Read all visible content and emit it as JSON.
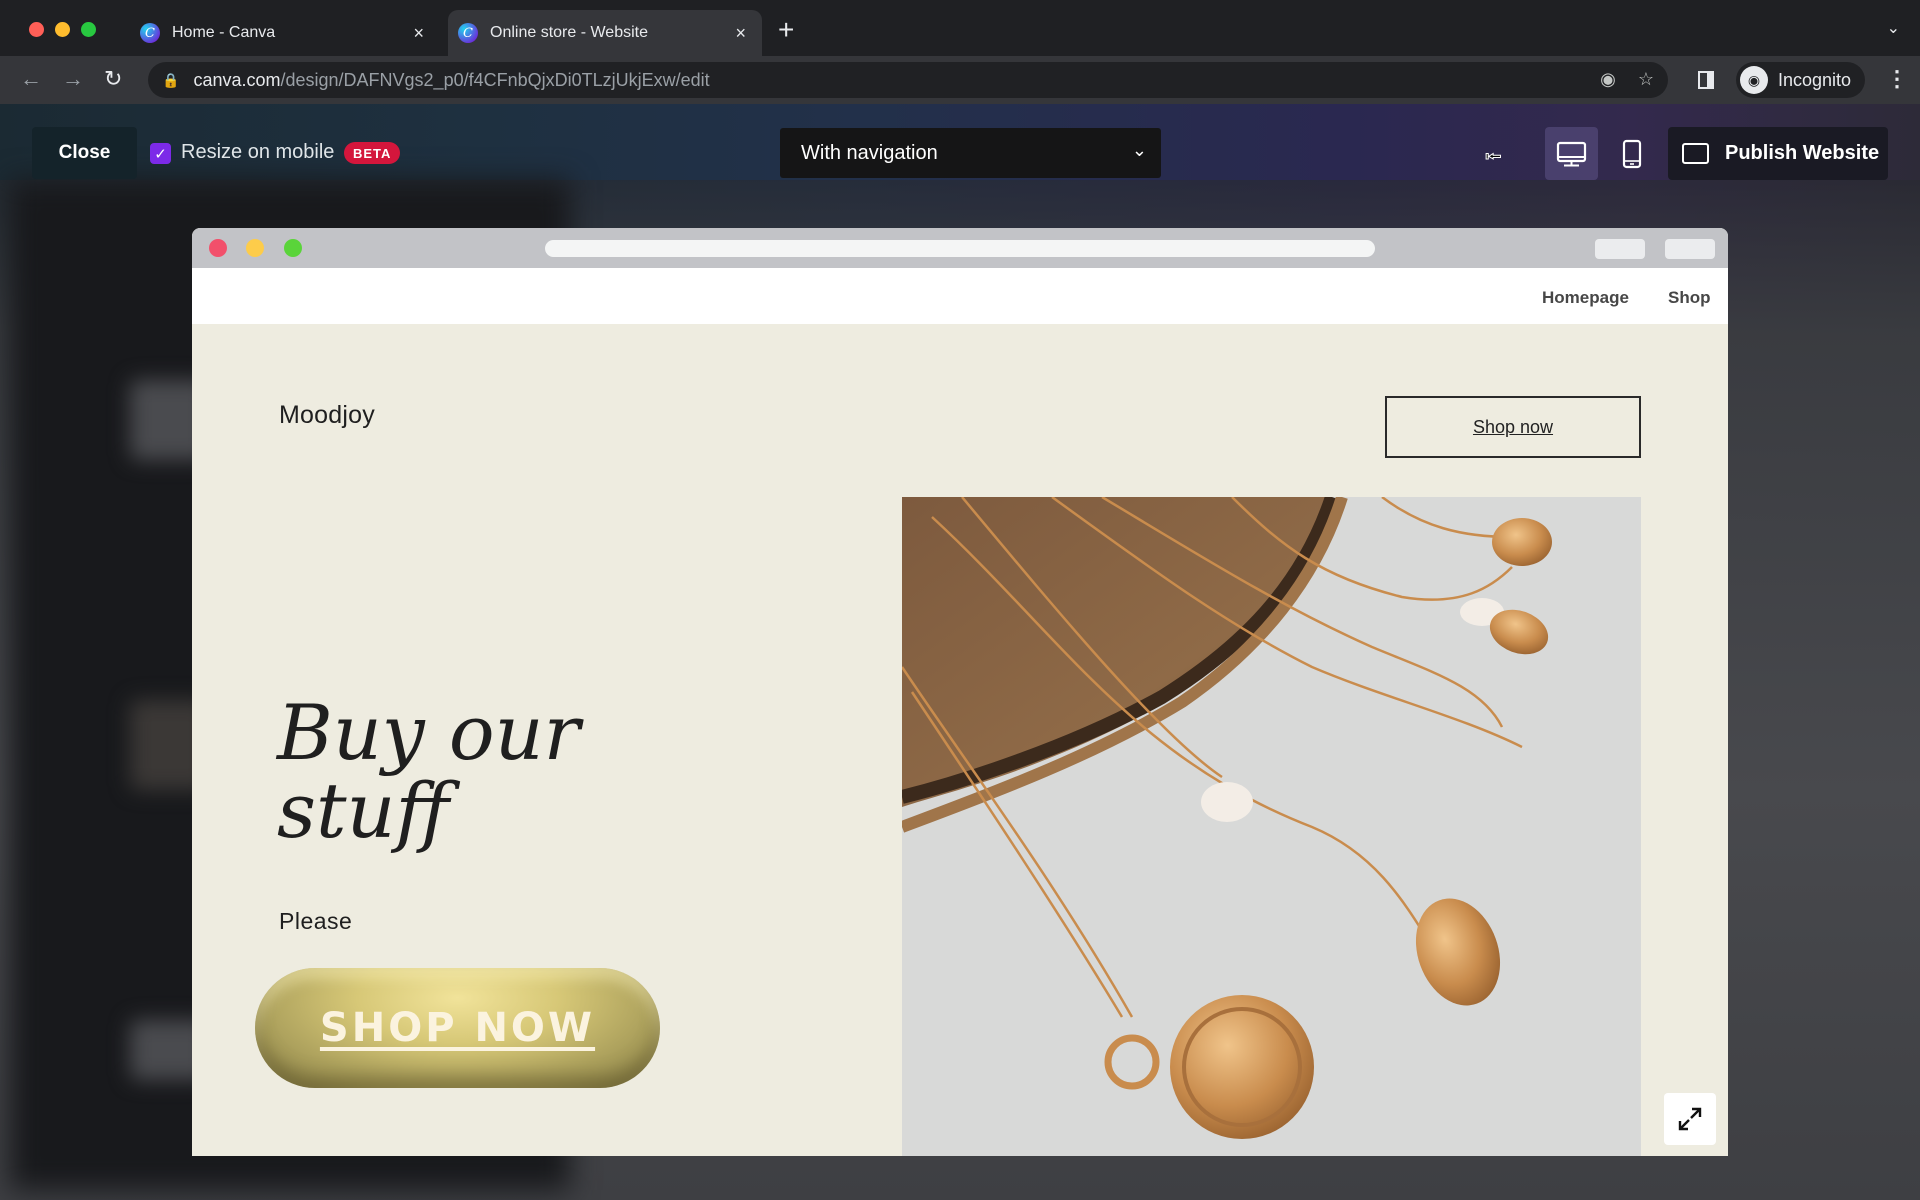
{
  "browser": {
    "tabs": [
      {
        "title": "Home - Canva",
        "active": false,
        "favicon": "canva-icon"
      },
      {
        "title": "Online store - Website",
        "active": true,
        "favicon": "canva-icon"
      }
    ],
    "new_tab_icon": "+",
    "tab_close_icon": "×",
    "url_host": "canva.com",
    "url_path": "/design/DAFNVgs2_p0/f4CFnbQjxDi0TLzjUkjExw/edit",
    "profile_label": "Incognito",
    "icons": [
      "back-icon",
      "forward-icon",
      "reload-icon",
      "lock-icon",
      "eye-off-icon",
      "star-icon",
      "side-panel-icon",
      "incognito-icon",
      "kebab-menu-icon"
    ]
  },
  "canva_toolbar": {
    "close_label": "Close",
    "resize_on_mobile_label": "Resize on mobile",
    "resize_on_mobile_checked": true,
    "beta_badge": "BETA",
    "navigation_select_value": "With navigation",
    "publish_label": "Publish Website",
    "view_modes": [
      "desktop",
      "mobile"
    ],
    "active_view_mode": "desktop",
    "colors": {
      "checkbox": "#7c2ae8",
      "beta": "#d4163c"
    }
  },
  "site_preview": {
    "nav_links": [
      "Homepage",
      "Shop"
    ],
    "brand": "Moodjoy",
    "header_button": "Shop now",
    "heading": "Buy our stuff",
    "subtext": "Please",
    "cta_button": "SHOP NOW",
    "image_description": "gold necklaces with coin and pearl pendants on a wooden tray",
    "colors": {
      "background": "#eeece0",
      "cta_gold": "#d7c877"
    }
  }
}
